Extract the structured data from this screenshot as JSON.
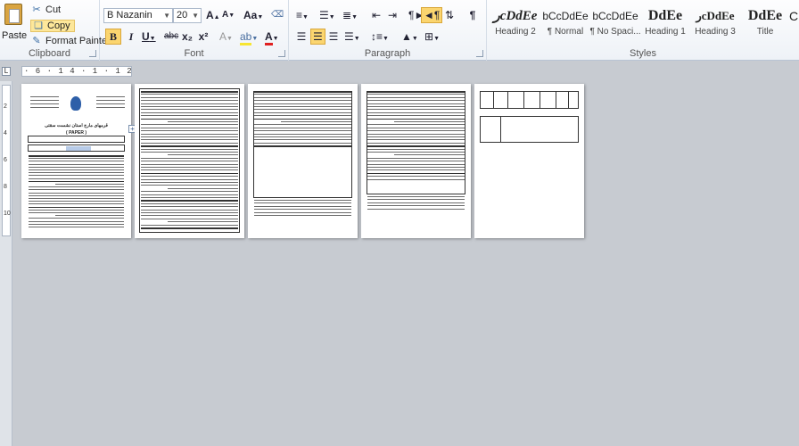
{
  "clipboard": {
    "paste_label": "Paste",
    "cut_label": "Cut",
    "copy_label": "Copy",
    "format_painter_label": "Format Painter",
    "group_label": "Clipboard"
  },
  "font": {
    "name": "B Nazanin",
    "size": "20",
    "grow_label": "A",
    "shrink_label": "A",
    "change_case_label": "Aa",
    "bold": "B",
    "italic": "I",
    "underline": "U",
    "strikethrough": "abc",
    "subscript": "x₂",
    "superscript": "x²",
    "font_color_label": "A",
    "group_label": "Font"
  },
  "paragraph": {
    "group_label": "Paragraph",
    "show_marks_label": "¶"
  },
  "styles": {
    "group_label": "Styles",
    "items": [
      {
        "sample": "رcDdEe",
        "name": "Heading 2"
      },
      {
        "sample": "bCcDdEe",
        "name": "¶ Normal"
      },
      {
        "sample": "bCcDdEe",
        "name": "¶ No Spaci..."
      },
      {
        "sample": "DdEe",
        "name": "Heading 1"
      },
      {
        "sample": "رcDdEe",
        "name": "Heading 3"
      },
      {
        "sample": "DdEe",
        "name": "Title"
      }
    ]
  },
  "ruler": {
    "tab_marker": "L",
    "text": "· 6 · 1 4 · 1 · 1 2 · 1 ·",
    "vertical_marks": [
      "2",
      "4",
      "6",
      "8",
      "10"
    ]
  },
  "cover_page": {
    "title": "قرمهای مارج استان نشست سقتی",
    "subtitle": "( PAPER )"
  },
  "colors": {
    "copy_highlight": "#fde79a",
    "active_toggle": "#fbd56f",
    "workspace": "#c7cbd1",
    "font_color_bar": "#e02020",
    "highlight_bar": "#f7e531"
  }
}
